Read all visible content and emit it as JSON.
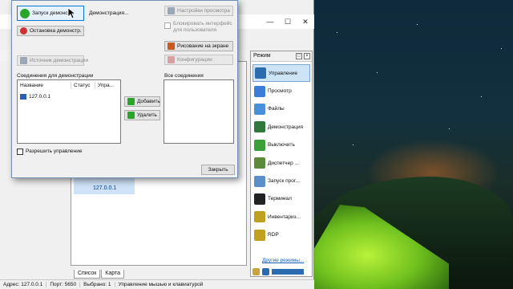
{
  "dialog": {
    "start_button": "Запуск демонстр.",
    "start_status": "Демонстрация...",
    "stop_button": "Остановка демонстр.",
    "source_button": "Источник демонстрации",
    "viewer_settings_button": "Настройки просмотра",
    "block_interface_line1": "Блокировать интерфейс",
    "block_interface_line2": "для пользователя",
    "draw_on_screen_button": "Рисование на экране",
    "config_button": "Конфигурации",
    "connections_label": "Соединения для демонстрации",
    "columns": [
      "Название",
      "Статус",
      "Упра..."
    ],
    "connections": [
      {
        "name": "127.0.0.1"
      }
    ],
    "add_button": "Добавить",
    "remove_button": "Удалить",
    "all_connections_label": "Все соединения",
    "allow_control_label": "Разрешить управление",
    "close_button": "Закрыть"
  },
  "main": {
    "host_label": "127.0.0.1",
    "tabs": [
      "Список",
      "Карта"
    ],
    "mode_panel": {
      "title": "Режим",
      "items": [
        {
          "label": "Управление",
          "icon": "control-icon",
          "color": "#2b6cb0"
        },
        {
          "label": "Просмотр",
          "icon": "view-icon",
          "color": "#3b7dd8"
        },
        {
          "label": "Файлы",
          "icon": "files-icon",
          "color": "#4a90d9"
        },
        {
          "label": "Демонстрация",
          "icon": "demo-icon",
          "color": "#2f7a3a"
        },
        {
          "label": "Выключить",
          "icon": "power-icon",
          "color": "#3aa03a"
        },
        {
          "label": "Диспетчер ...",
          "icon": "task-manager-icon",
          "color": "#5a8a3a"
        },
        {
          "label": "Запуск прог...",
          "icon": "run-icon",
          "color": "#5b8fc8"
        },
        {
          "label": "Терминал",
          "icon": "terminal-icon",
          "color": "#222222"
        },
        {
          "label": "Инвентариз...",
          "icon": "inventory-icon",
          "color": "#c0a020"
        },
        {
          "label": "RDP",
          "icon": "rdp-icon",
          "color": "#c0a020"
        }
      ],
      "more_link": "Другие режимы..."
    }
  },
  "status_bar": {
    "address": "Адрес: 127.0.0.1",
    "port": "Порт: 5650",
    "selected": "Выбрано: 1",
    "mode": "Управление мышью и клавиатурой"
  },
  "colors": {
    "accent": "#0078d7",
    "selection": "#cde4f7"
  }
}
